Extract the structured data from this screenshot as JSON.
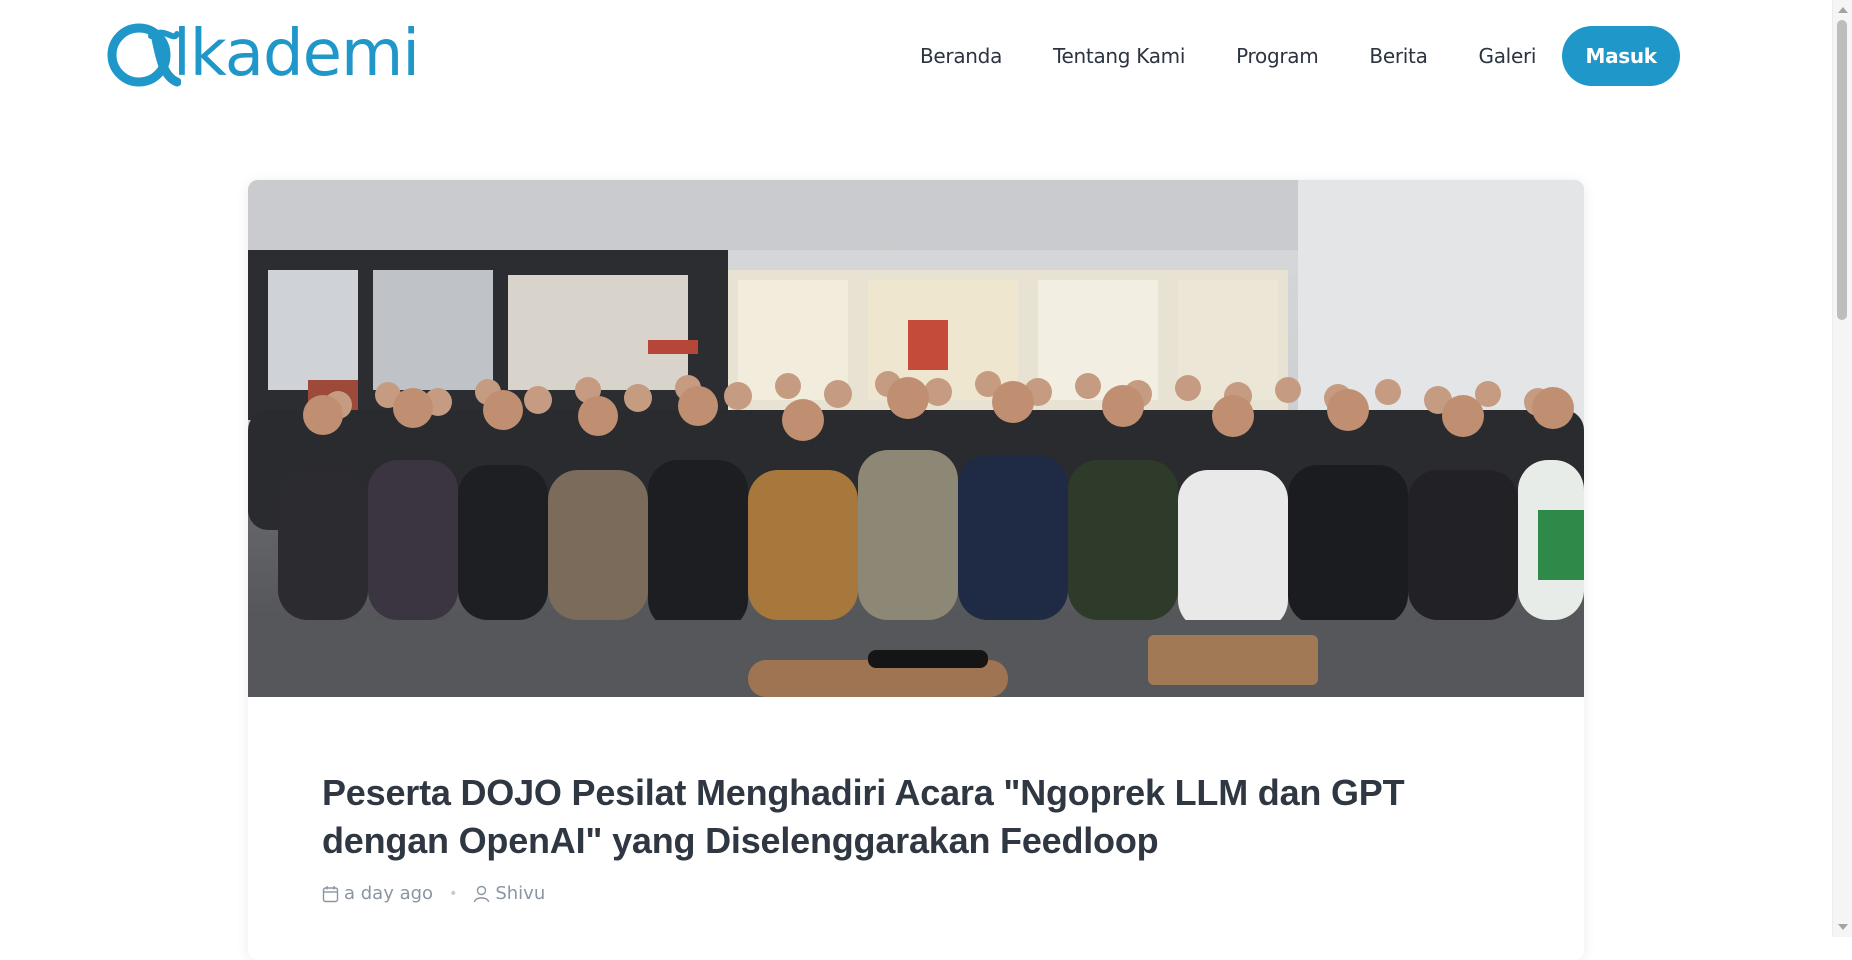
{
  "brand": {
    "name": "lkademi",
    "color": "#1f97c9",
    "logo_icon": "alpha-logo-icon"
  },
  "nav": {
    "items": [
      {
        "label": "Beranda"
      },
      {
        "label": "Tentang Kami"
      },
      {
        "label": "Program"
      },
      {
        "label": "Berita"
      },
      {
        "label": "Galeri"
      }
    ],
    "login_label": "Masuk"
  },
  "article": {
    "hero_image": "group-photo-event-audience",
    "title": "Peserta DOJO Pesilat Menghadiri Acara \"Ngoprek LLM dan GPT dengan OpenAI\" yang Diselenggarakan Feedloop",
    "date": "a day ago",
    "author": "Shivu",
    "date_icon": "calendar-icon",
    "author_icon": "user-icon"
  }
}
